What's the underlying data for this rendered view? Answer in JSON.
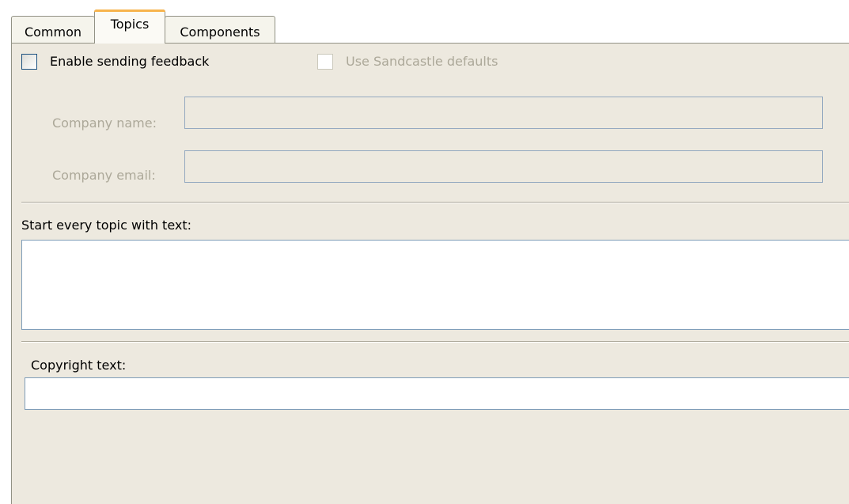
{
  "tabs": [
    {
      "label": "Common",
      "active": false
    },
    {
      "label": "Topics",
      "active": true
    },
    {
      "label": "Components",
      "active": false
    }
  ],
  "feedback": {
    "enable_label": "Enable sending feedback",
    "enable_checked": false,
    "sandcastle_label": "Use Sandcastle defaults",
    "sandcastle_checked": false,
    "sandcastle_enabled": false,
    "company_name_label": "Company name:",
    "company_name_value": "",
    "company_email_label": "Company email:",
    "company_email_value": ""
  },
  "topic_text": {
    "label": "Start every topic with text:",
    "value": ""
  },
  "copyright": {
    "label": "Copyright text:",
    "value": ""
  },
  "colors": {
    "panel_bg": "#ede9df",
    "active_tab_accent": "#f7b44d",
    "input_border": "#7f9db9",
    "disabled_text": "#aca899"
  }
}
